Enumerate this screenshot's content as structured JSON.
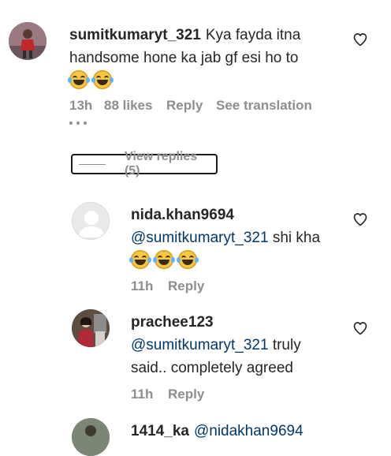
{
  "comment": {
    "username": "sumitkumaryt_321",
    "text": "Kya fayda itna handsome hone ka jab gf esi ho to",
    "emoji_count": 2,
    "time": "13h",
    "likes": "88 likes",
    "reply_label": "Reply",
    "see_translation": "See translation",
    "more_icon": "more-dots-icon",
    "like_icon": "heart-outline-icon"
  },
  "view_replies": {
    "label": "View replies (5)"
  },
  "replies": [
    {
      "username": "nida.khan9694",
      "mention": "@sumitkumaryt_321",
      "text": "shi kha",
      "emoji_count": 3,
      "time": "11h",
      "reply_label": "Reply"
    },
    {
      "username": "prachee123",
      "mention": "@sumitkumaryt_321",
      "text": "truly said.. completely agreed",
      "time": "11h",
      "reply_label": "Reply"
    },
    {
      "username": "1414_ka",
      "mention": "@nidakhan9694"
    }
  ],
  "colors": {
    "text": "#262626",
    "meta": "#8e8e8e",
    "mention": "#00376b",
    "emoji_face": "#f7c744"
  }
}
